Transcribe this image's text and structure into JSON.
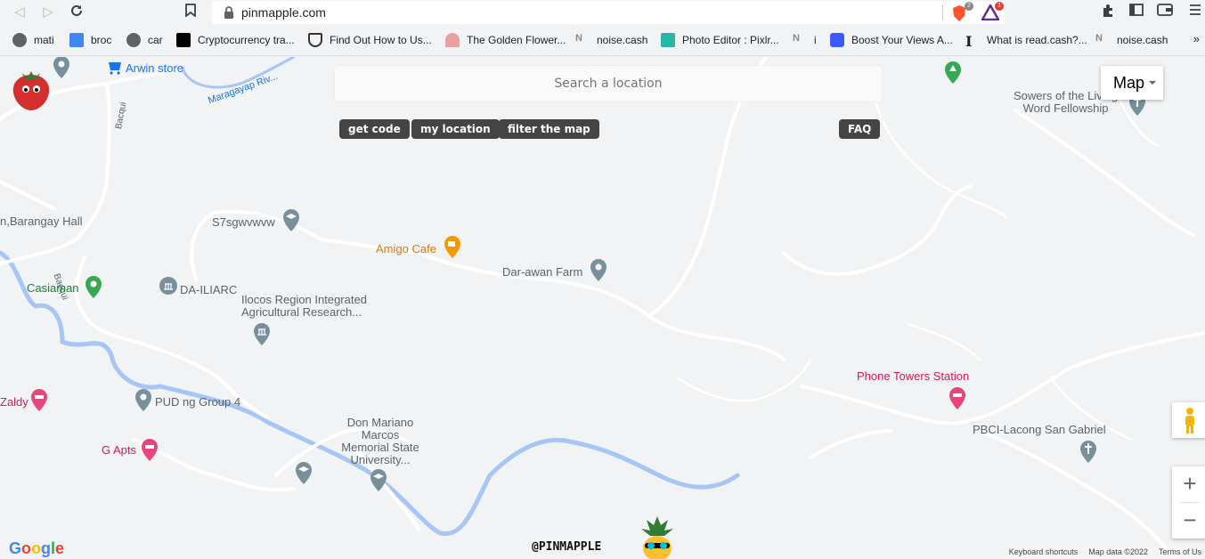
{
  "browser": {
    "url": "pinmapple.com",
    "bookmarks": [
      {
        "label": "mati",
        "icon": "globe-icon"
      },
      {
        "label": "broc",
        "icon": "docs-icon"
      },
      {
        "label": "car",
        "icon": "globe-icon"
      },
      {
        "label": "Cryptocurrency tra...",
        "icon": "crypto-icon"
      },
      {
        "label": "Find Out How to Us...",
        "icon": "shield-icon"
      },
      {
        "label": "The Golden Flower...",
        "icon": "flower-icon"
      },
      {
        "label": "noise.cash",
        "icon": "noise-icon"
      },
      {
        "label": "Photo Editor : Pixlr...",
        "icon": "pixlr-icon"
      },
      {
        "label": "i",
        "icon": "noise-icon"
      },
      {
        "label": "Boost Your Views A...",
        "icon": "play-icon"
      },
      {
        "label": "What is read.cash?...",
        "icon": "readcash-icon"
      },
      {
        "label": "noise.cash",
        "icon": "noise-icon"
      }
    ],
    "more": "»",
    "brave_badge": "2",
    "rewards_badge": "1"
  },
  "map": {
    "search_placeholder": "Search a location",
    "buttons": {
      "get_code": "get code",
      "my_location": "my location",
      "filter": "filter the map",
      "faq": "FAQ"
    },
    "map_type": "Map",
    "zoom_in": "+",
    "zoom_out": "−",
    "places": {
      "arwin": "Arwin store",
      "maragayap": "Maragayap Riv...",
      "sowers1": "Sowers of the Living",
      "sowers2": "Word Fellowship",
      "bacqui1": "Bacqui",
      "bacqui2": "Bacqui",
      "barangay": "n,Barangay Hall",
      "s7": "S7sgwvwvw",
      "amigo": "Amigo Cafe",
      "darawan": "Dar-awan Farm",
      "casiaman": "Casiaman",
      "dailiarc": "DA-ILIARC",
      "ilocos1": "Ilocos Region Integrated",
      "ilocos2": "Agricultural Research...",
      "phone": "Phone Towers Station",
      "zaldy": "Zaldy",
      "pud": "PUD ng Group 4",
      "dmmmsu1": "Don Mariano",
      "dmmmsu2": "Marcos",
      "dmmmsu3": "Memorial State",
      "dmmmsu4": "University...",
      "pbci": "PBCI-Lacong San Gabriel",
      "gapts": "G Apts"
    },
    "handle": "@PINMAPPLE",
    "google": "Google",
    "attribution": [
      "Keyboard shortcuts",
      "Map data ©2022",
      "Terms of Us"
    ]
  }
}
